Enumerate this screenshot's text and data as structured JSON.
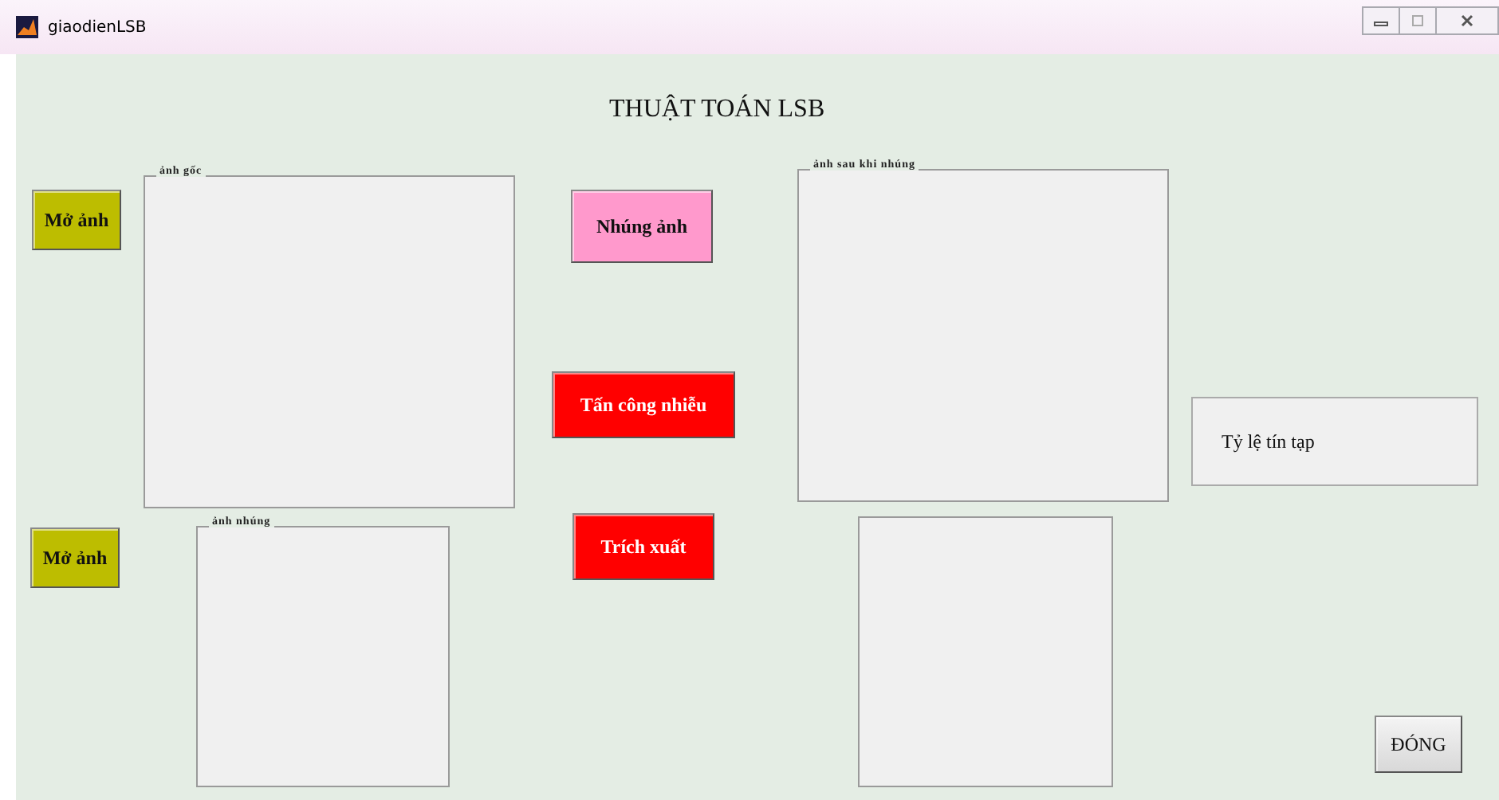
{
  "window": {
    "title": "giaodienLSB"
  },
  "heading": "THUẬT TOÁN LSB",
  "open_cover_button": "Mở ảnh",
  "cover_panel": {
    "title": "ảnh gốc"
  },
  "embed_button": "Nhúng ảnh",
  "stego_panel": {
    "title": "ảnh sau khi nhúng"
  },
  "noise_attack_button": "Tấn công nhiễu",
  "snr_panel": {
    "label": "Tỷ lệ tín tạp"
  },
  "open_secret_button": "Mở ảnh",
  "secret_panel": {
    "title": "ảnh nhúng"
  },
  "extract_button": "Trích xuất",
  "close_button": "ĐÓNG"
}
